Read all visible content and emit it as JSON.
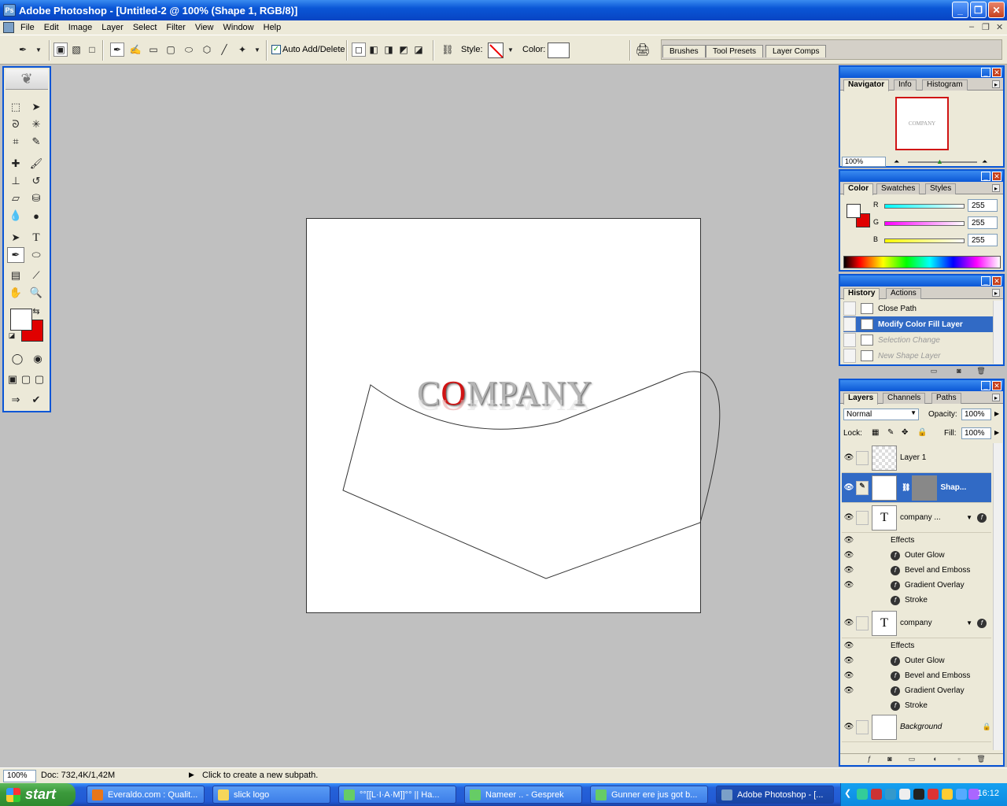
{
  "window": {
    "title": "Adobe Photoshop - [Untitled-2 @ 100% (Shape 1, RGB/8)]"
  },
  "menu": [
    "File",
    "Edit",
    "Image",
    "Layer",
    "Select",
    "Filter",
    "View",
    "Window",
    "Help"
  ],
  "options_bar": {
    "auto_add_delete_label": "Auto Add/Delete",
    "auto_add_delete_checked": true,
    "style_label": "Style:",
    "color_label": "Color:",
    "palette_well_tabs": [
      "Brushes",
      "Tool Presets",
      "Layer Comps"
    ]
  },
  "canvas": {
    "logo_part1": "C",
    "logo_red": "O",
    "logo_part2": "MPANY"
  },
  "navigator": {
    "tabs": [
      "Navigator",
      "Info",
      "Histogram"
    ],
    "zoom": "100%",
    "thumb_text": "COMPANY"
  },
  "color_panel": {
    "tabs": [
      "Color",
      "Swatches",
      "Styles"
    ],
    "channels": [
      {
        "label": "R",
        "value": "255"
      },
      {
        "label": "G",
        "value": "255"
      },
      {
        "label": "B",
        "value": "255"
      }
    ]
  },
  "history": {
    "tabs": [
      "History",
      "Actions"
    ],
    "items": [
      {
        "label": "Close Path",
        "state": "normal"
      },
      {
        "label": "Modify Color Fill Layer",
        "state": "selected"
      },
      {
        "label": "Selection Change",
        "state": "dim"
      },
      {
        "label": "New Shape Layer",
        "state": "dim"
      }
    ]
  },
  "layers": {
    "tabs": [
      "Layers",
      "Channels",
      "Paths"
    ],
    "blend_mode": "Normal",
    "opacity_label": "Opacity:",
    "opacity": "100%",
    "lock_label": "Lock:",
    "fill_label": "Fill:",
    "fill": "100%",
    "items": [
      {
        "name": "Layer 1"
      },
      {
        "name": "Shap..."
      },
      {
        "name": "company ...",
        "effects_label": "Effects",
        "effects": [
          "Outer Glow",
          "Bevel and Emboss",
          "Gradient Overlay",
          "Stroke"
        ]
      },
      {
        "name": "company",
        "effects_label": "Effects",
        "effects": [
          "Outer Glow",
          "Bevel and Emboss",
          "Gradient Overlay",
          "Stroke"
        ]
      },
      {
        "name": "Background"
      }
    ]
  },
  "status": {
    "zoom": "100%",
    "doc": "Doc: 732,4K/1,42M",
    "hint": "Click to create a new subpath."
  },
  "taskbar": {
    "start": "start",
    "tasks": [
      {
        "label": "Everaldo.com : Qualit...",
        "active": false
      },
      {
        "label": "slick logo",
        "active": false
      },
      {
        "label": "°°[[L·I·A·M]]°° || Ha...",
        "active": false
      },
      {
        "label": "Nameer .. - Gesprek",
        "active": false
      },
      {
        "label": "Gunner ere jus got b...",
        "active": false
      },
      {
        "label": "Adobe Photoshop - [...",
        "active": true
      }
    ],
    "clock": "16:12"
  },
  "colors": {
    "accent": "#0a56d6",
    "foreground_swatch": "#ffffff",
    "background_swatch": "#e00000",
    "logo_red": "#d01414"
  }
}
